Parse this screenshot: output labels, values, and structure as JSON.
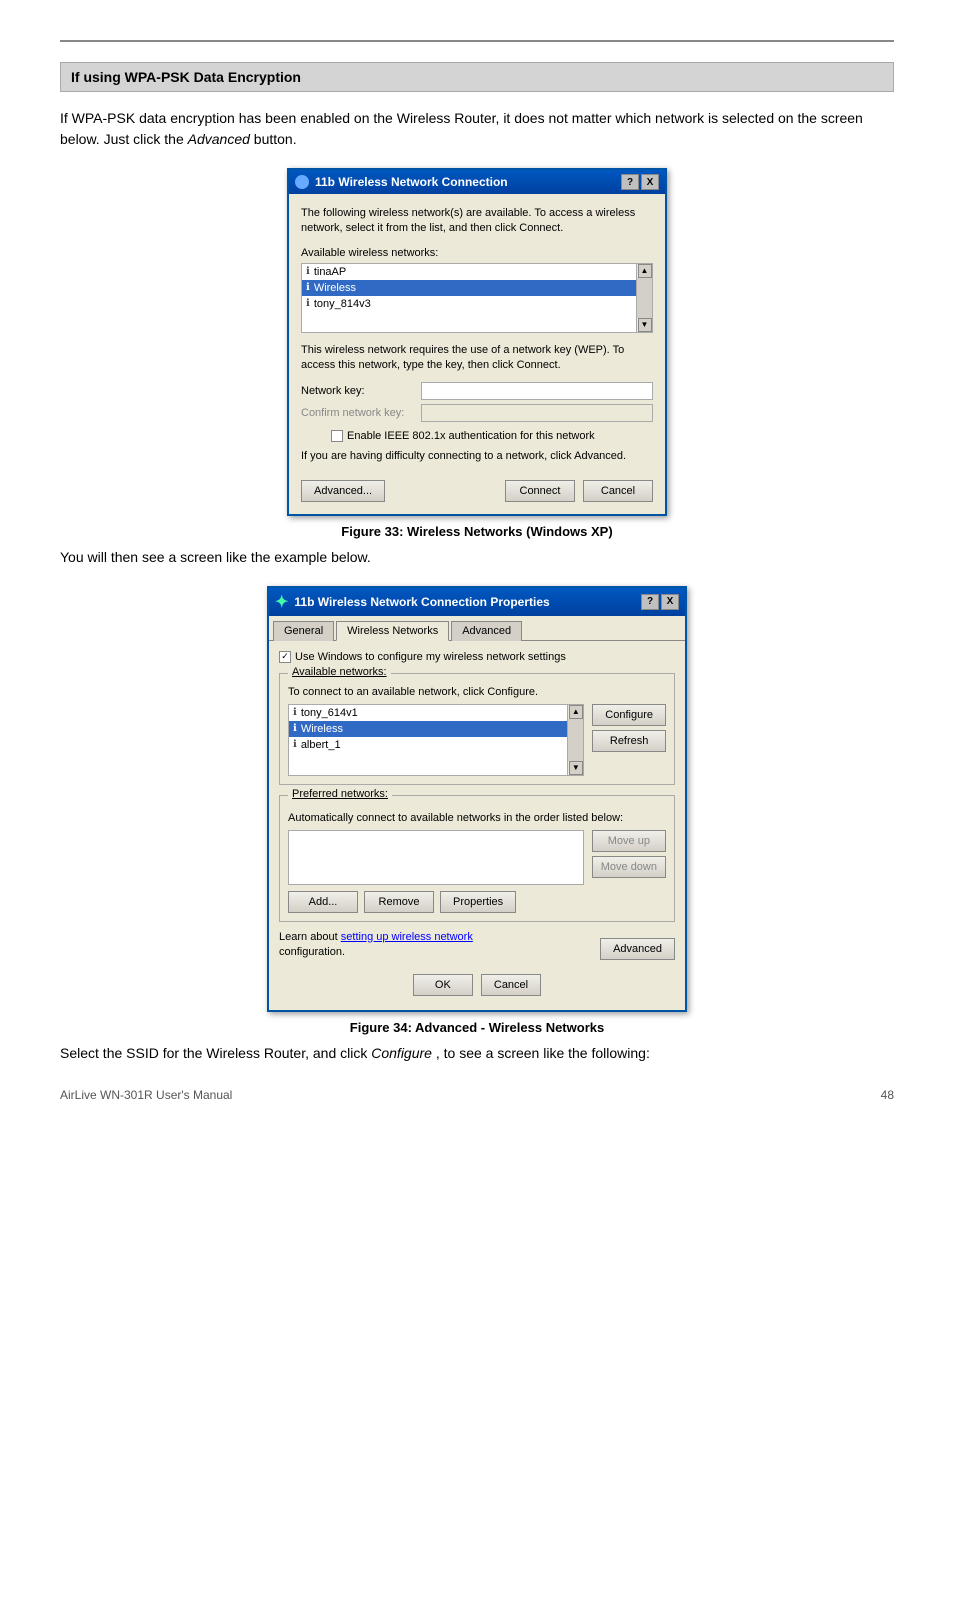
{
  "page": {
    "top_border": true,
    "section_heading": "If using WPA-PSK Data Encryption",
    "intro_text": "If WPA-PSK data encryption has been enabled on the Wireless Router, it does not matter which network is selected on the screen below. Just click the",
    "intro_italic": "Advanced",
    "intro_text2": "button.",
    "figure1": {
      "caption": "Figure 33: Wireless Networks (Windows XP)"
    },
    "between_text": "You will then see a screen like the example below.",
    "figure2": {
      "caption": "Figure 34: Advanced - Wireless Networks"
    },
    "conclusion_text": "Select the SSID for the Wireless Router, and click",
    "conclusion_italic": "Configure",
    "conclusion_text2": ", to see a screen like the following:"
  },
  "dialog1": {
    "title": "11b Wireless Network Connection",
    "help_btn": "?",
    "close_btn": "X",
    "body_text": "The following wireless network(s) are available. To access a wireless network, select it from the list, and then click Connect.",
    "available_label": "Available wireless networks:",
    "networks": [
      {
        "name": "tinaAP",
        "selected": false
      },
      {
        "name": "Wireless",
        "selected": true
      },
      {
        "name": "tony_814v3",
        "selected": false
      }
    ],
    "wep_text": "This wireless network requires the use of a network key (WEP). To access this network, type the key, then click Connect.",
    "network_key_label": "Network key:",
    "confirm_key_label": "Confirm network key:",
    "checkbox_label": "Enable IEEE 802.1x authentication for this network",
    "advanced_link_text": "If you are having difficulty connecting to a network, click Advanced.",
    "buttons": {
      "advanced": "Advanced...",
      "connect": "Connect",
      "cancel": "Cancel"
    }
  },
  "dialog2": {
    "title": "11b Wireless Network Connection Properties",
    "help_btn": "?",
    "close_btn": "X",
    "tabs": [
      "General",
      "Wireless Networks",
      "Advanced"
    ],
    "active_tab": "Wireless Networks",
    "use_windows_label": "Use Windows to configure my wireless network settings",
    "available_networks": {
      "label": "Available networks:",
      "connect_text": "To connect to an available network, click Configure.",
      "networks": [
        {
          "name": "tony_614v1",
          "selected": false
        },
        {
          "name": "Wireless",
          "selected": true
        },
        {
          "name": "albert_1",
          "selected": false
        }
      ],
      "configure_btn": "Configure",
      "refresh_btn": "Refresh"
    },
    "preferred_networks": {
      "label": "Preferred networks:",
      "desc": "Automatically connect to available networks in the order listed below:",
      "move_up_btn": "Move up",
      "move_down_btn": "Move down",
      "add_btn": "Add...",
      "remove_btn": "Remove",
      "properties_btn": "Properties"
    },
    "learn_text": "Learn about",
    "learn_link": "setting up wireless network",
    "learn_text2": "configuration.",
    "advanced_btn": "Advanced",
    "ok_btn": "OK",
    "cancel_btn": "Cancel"
  },
  "footer": {
    "left": "AirLive WN-301R User's Manual",
    "page_number": "48"
  }
}
